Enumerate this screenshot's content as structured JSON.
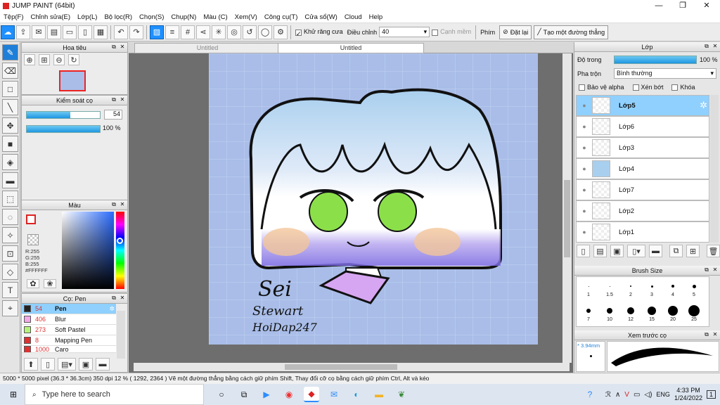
{
  "window": {
    "title": "JUMP PAINT (64bit)",
    "minimize": "—",
    "restore": "❐",
    "close": "✕"
  },
  "menu": [
    "Tệp(F)",
    "Chỉnh sửa(E)",
    "Lớp(L)",
    "Bộ lọc(R)",
    "Chọn(S)",
    "Chụp(N)",
    "Màu (C)",
    "Xem(V)",
    "Công cụ(T)",
    "Cửa sổ(W)",
    "Cloud",
    "Help"
  ],
  "toolbar": {
    "antialias_label": "Khử răng cưa",
    "adjust_label": "Điều chỉnh",
    "adjust_value": "40",
    "smooth_label": "Cạnh mềm",
    "key_label": "Phím",
    "reset_label": "Đặt lại",
    "line_label": "Tạo một đường thẳng"
  },
  "navigator": {
    "title": "Hoa tiêu"
  },
  "brush_control": {
    "title": "Kiểm soát cọ",
    "size_value": "54",
    "opacity_value": "100 %",
    "size_fraction": 0.6,
    "opacity_fraction": 1.0
  },
  "color_panel": {
    "title": "Màu",
    "r": "R:255",
    "g": "G:255",
    "b": "B:255",
    "hex": "#FFFFFF"
  },
  "pen_panel": {
    "title": "Cọ: Pen",
    "items": [
      {
        "size": "54",
        "name": "Pen",
        "color": "#222222"
      },
      {
        "size": "406",
        "name": "Blur",
        "color": "#f3a8e8"
      },
      {
        "size": "273",
        "name": "Soft Pastel",
        "color": "#b5f27a"
      },
      {
        "size": "8",
        "name": "Mapping Pen",
        "color": "#e03030"
      },
      {
        "size": "1000",
        "name": "Caro",
        "color": "#e03030"
      }
    ]
  },
  "tabs": [
    "Untitled",
    "Untitled"
  ],
  "canvas_text": {
    "signature1": "Sei",
    "signature2": "Stewart",
    "signature3": "HoiDap247"
  },
  "layer_panel": {
    "title": "Lớp",
    "opacity_label": "Độ trong",
    "opacity_value": "100 %",
    "opacity_fraction": 1.0,
    "blend_label": "Pha trộn",
    "blend_value": "Bình thường",
    "protect_alpha": "Bảo vệ alpha",
    "clip": "Xén bớt",
    "lock": "Khóa",
    "layers": [
      "Lớp5",
      "Lớp6",
      "Lớp3",
      "Lớp4",
      "Lớp7",
      "Lớp2",
      "Lớp1"
    ]
  },
  "brush_size": {
    "title": "Brush Size",
    "sizes": [
      "1",
      "1.5",
      "2",
      "3",
      "4",
      "5",
      "7",
      "10",
      "12",
      "15",
      "20",
      "25"
    ]
  },
  "brush_preview": {
    "title": "Xem trước cọ",
    "value": "* 3.94mm"
  },
  "status": "5000 * 5000 pixel  (36.3 * 36.3cm)  350 dpi  12 %  ( 1292, 2364 )  Vẽ một đường thẳng bằng cách giữ phím Shift, Thay đổi cỡ cọ bằng cách giữ phím Ctrl, Alt và kéo",
  "taskbar": {
    "search_placeholder": "Type here to search",
    "lang": "ENG",
    "time": "4:33 PM",
    "date": "1/24/2022",
    "notif": "1"
  }
}
